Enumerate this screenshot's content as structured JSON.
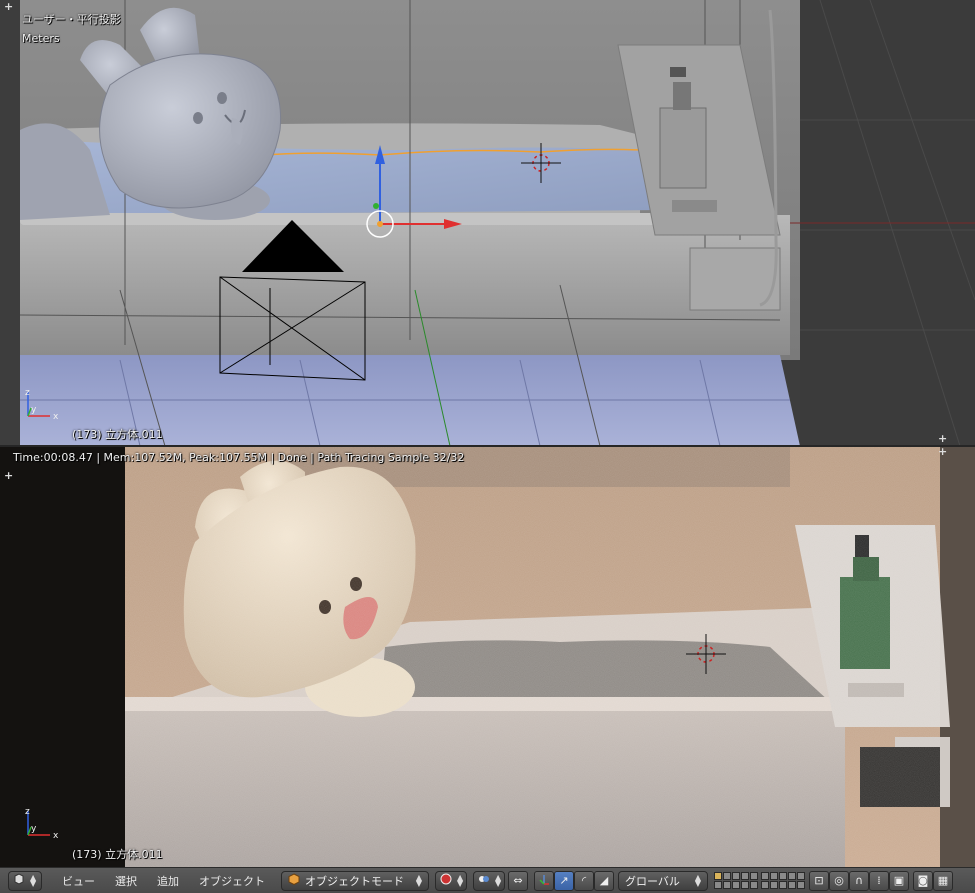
{
  "top_viewport": {
    "view_name": "ユーザー・平行投影",
    "units": "Meters",
    "object_info": "(173) 立方体.011"
  },
  "bottom_viewport": {
    "render_status": "Time:00:08.47 | Mem:107.52M, Peak:107.55M | Done | Path Tracing Sample 32/32",
    "object_info": "(173) 立方体.011"
  },
  "header": {
    "menus": [
      "ビュー",
      "選択",
      "追加",
      "オブジェクト"
    ],
    "mode_label": "オブジェクトモード",
    "orientation_label": "グローバル"
  },
  "colors": {
    "selection_outline": "#f0a030",
    "axis_x": "#e03030",
    "axis_y": "#30b030",
    "axis_z": "#3060e0",
    "active_button": "#5680c2"
  },
  "icons": [
    "editor-type-icon",
    "object-mode-icon",
    "viewport-shading-icon",
    "pivot-point-icon",
    "snap-icon",
    "manipulator-icon",
    "translate-icon",
    "rotate-icon",
    "scale-icon",
    "render-icon",
    "camera-icon"
  ]
}
